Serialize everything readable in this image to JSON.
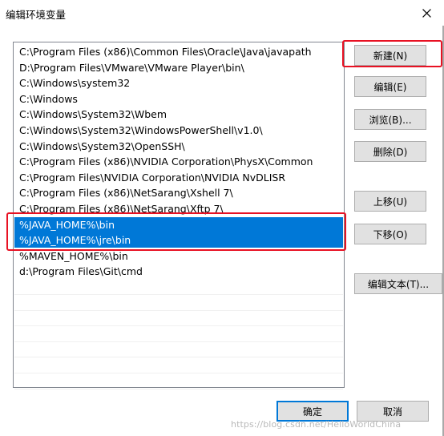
{
  "window": {
    "title": "编辑环境变量"
  },
  "path_list": {
    "items": [
      "C:\\Program Files (x86)\\Common Files\\Oracle\\Java\\javapath",
      "D:\\Program Files\\VMware\\VMware Player\\bin\\",
      "C:\\Windows\\system32",
      "C:\\Windows",
      "C:\\Windows\\System32\\Wbem",
      "C:\\Windows\\System32\\WindowsPowerShell\\v1.0\\",
      "C:\\Windows\\System32\\OpenSSH\\",
      "C:\\Program Files (x86)\\NVIDIA Corporation\\PhysX\\Common",
      "C:\\Program Files\\NVIDIA Corporation\\NVIDIA NvDLISR",
      "C:\\Program Files (x86)\\NetSarang\\Xshell 7\\",
      "C:\\Program Files (x86)\\NetSarang\\Xftp 7\\",
      "%JAVA_HOME%\\bin",
      "%JAVA_HOME%\\jre\\bin",
      "%MAVEN_HOME%\\bin",
      "d:\\Program Files\\Git\\cmd"
    ],
    "selected_indices": [
      11,
      12
    ]
  },
  "buttons": {
    "new": "新建(N)",
    "edit": "编辑(E)",
    "browse": "浏览(B)...",
    "delete": "删除(D)",
    "move_up": "上移(U)",
    "move_down": "下移(O)",
    "edit_text": "编辑文本(T)...",
    "ok": "确定",
    "cancel": "取消"
  },
  "watermark": "https://blog.csdn.net/HelloWorldChina",
  "colors": {
    "selection": "#0078d7",
    "annotation_box": "#e81123",
    "button_face": "#e1e1e1"
  }
}
